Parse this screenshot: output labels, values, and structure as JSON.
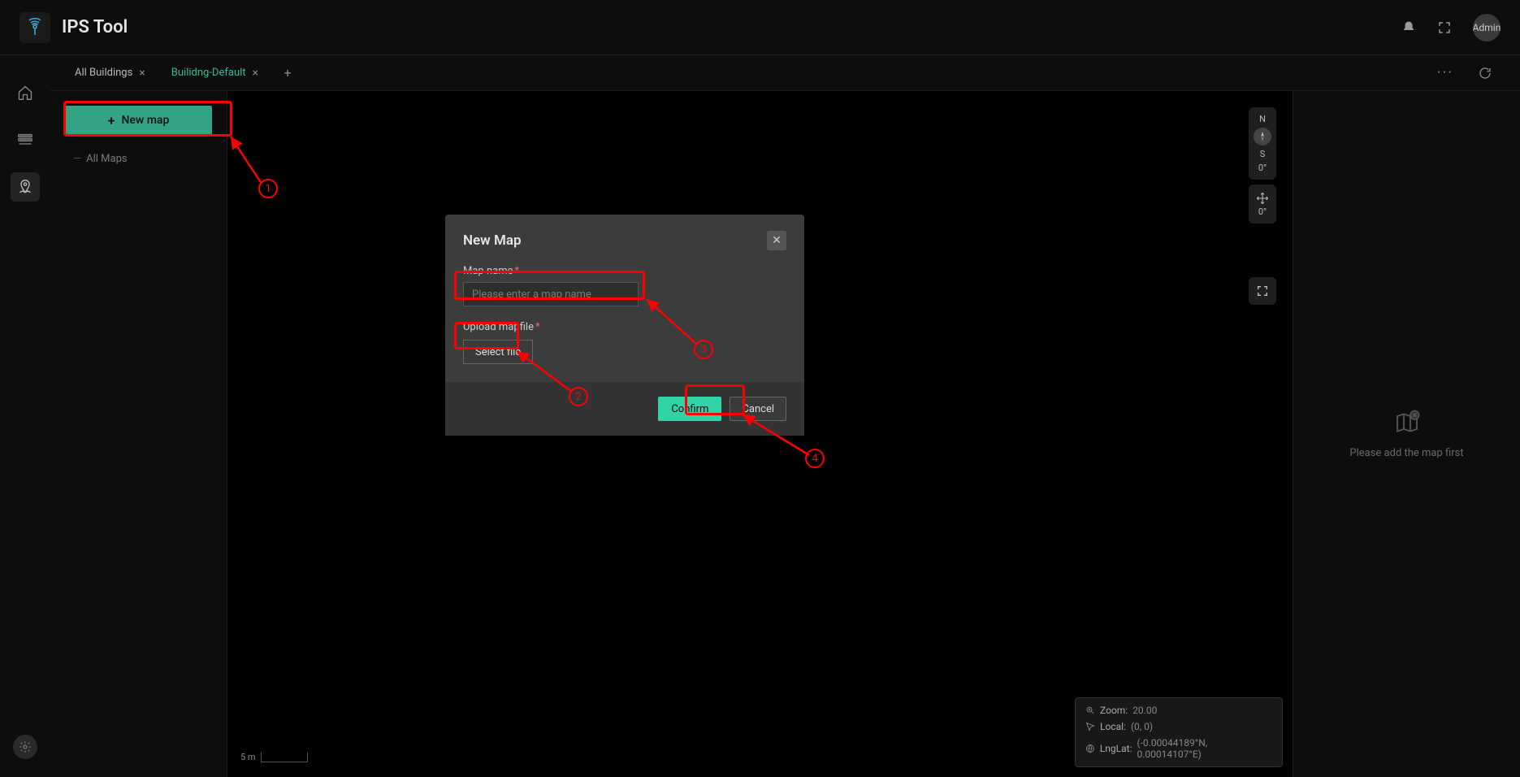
{
  "app": {
    "title": "IPS Tool",
    "user": "Admin"
  },
  "tabs": {
    "items": [
      {
        "label": "All Buildings",
        "active": false
      },
      {
        "label": "Builidng-Default",
        "active": true
      }
    ]
  },
  "sidebar": {
    "new_map_label": "New map",
    "all_maps_label": "All Maps"
  },
  "compass": {
    "north": "N",
    "south": "S",
    "degrees": "0°"
  },
  "move_ctrl": {
    "degrees": "0°"
  },
  "scale": {
    "label": "5 m"
  },
  "status": {
    "zoom_key": "Zoom:",
    "zoom_val": "20.00",
    "local_key": "Local:",
    "local_val": "(0, 0)",
    "lnglat_key": "LngLat:",
    "lnglat_val": "(-0.00044189°N, 0.00014107°E)"
  },
  "inspector": {
    "empty_text": "Please add the map first"
  },
  "modal": {
    "title": "New Map",
    "map_name_label": "Map name",
    "map_name_placeholder": "Please enter a map name",
    "upload_label": "Upload mapfile",
    "select_file": "Select file",
    "confirm": "Confirm",
    "cancel": "Cancel"
  },
  "annotations": [
    "1",
    "2",
    "3",
    "4"
  ]
}
